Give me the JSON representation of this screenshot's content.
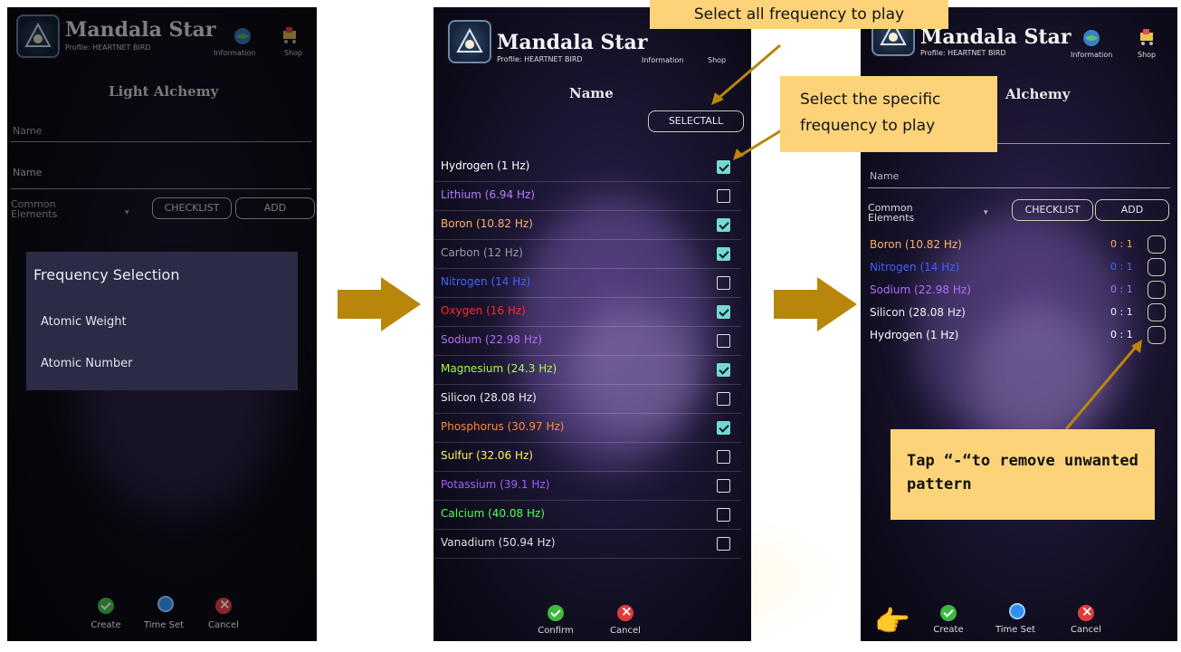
{
  "app": {
    "name": "Mandala Star",
    "profile": "Profile: HEARTNET BIRD",
    "info_label": "Information",
    "shop_label": "Shop"
  },
  "screen1": {
    "title": "Light Alchemy",
    "name_label": "Name",
    "name_value": "Name",
    "common_elements": "Common Elements",
    "checklist_label": "CHECKLIST",
    "add_label": "ADD",
    "menu": {
      "heading": "Frequency Selection",
      "options": [
        "Atomic Weight",
        "Atomic Number"
      ]
    },
    "footer": {
      "create": "Create",
      "time_set": "Time Set",
      "cancel": "Cancel"
    }
  },
  "screen2": {
    "title": "Name",
    "select_all_label": "SELECTALL",
    "items": [
      {
        "label": "Hydrogen (1 Hz)",
        "color": "#ffffff",
        "checked": true
      },
      {
        "label": "Lithium (6.94 Hz)",
        "color": "#b47cff",
        "checked": false
      },
      {
        "label": "Boron (10.82 Hz)",
        "color": "#ffb067",
        "checked": true
      },
      {
        "label": "Carbon (12 Hz)",
        "color": "#9a9aa2",
        "checked": true
      },
      {
        "label": "Nitrogen (14 Hz)",
        "color": "#3f63ff",
        "checked": false
      },
      {
        "label": "Oxygen (16 Hz)",
        "color": "#ff2a2a",
        "checked": true
      },
      {
        "label": "Sodium (22.98 Hz)",
        "color": "#b26cff",
        "checked": false
      },
      {
        "label": "Magnesium (24.3 Hz)",
        "color": "#a8ff3a",
        "checked": true
      },
      {
        "label": "Silicon (28.08 Hz)",
        "color": "#eeeeee",
        "checked": false
      },
      {
        "label": "Phosphorus (30.97 Hz)",
        "color": "#ff8a3a",
        "checked": true
      },
      {
        "label": "Sulfur (32.06 Hz)",
        "color": "#fff25a",
        "checked": false
      },
      {
        "label": "Potassium (39.1 Hz)",
        "color": "#a55dff",
        "checked": false
      },
      {
        "label": "Calcium (40.08 Hz)",
        "color": "#55ff55",
        "checked": false
      },
      {
        "label": "Vanadium (50.94 Hz)",
        "color": "#e0e0e0",
        "checked": false
      }
    ],
    "footer": {
      "confirm": "Confirm",
      "cancel": "Cancel"
    }
  },
  "screen3": {
    "title_partial": "Alchemy",
    "name_label": "Name",
    "common_elements": "Common Elements",
    "checklist_label": "CHECKLIST",
    "add_label": "ADD",
    "patterns": [
      {
        "label": "Boron (10.82 Hz)",
        "color": "#ffb067",
        "ratio": "0 : 1"
      },
      {
        "label": "Nitrogen (14 Hz)",
        "color": "#3f63ff",
        "ratio": "0 : 1"
      },
      {
        "label": "Sodium (22.98 Hz)",
        "color": "#b26cff",
        "ratio": "0 : 1"
      },
      {
        "label": "Silicon (28.08 Hz)",
        "color": "#eeeeee",
        "ratio": "0 : 1"
      },
      {
        "label": "Hydrogen (1 Hz)",
        "color": "#ffffff",
        "ratio": "0 : 1"
      }
    ],
    "footer": {
      "create": "Create",
      "time_set": "Time Set",
      "cancel": "Cancel"
    }
  },
  "callouts": {
    "select_all": "Select all frequency to play",
    "select_specific": "Select the specific frequency to play",
    "remove": "Tap “-“to remove unwanted pattern"
  },
  "colors": {
    "callout_bg": "#fdd37a",
    "arrow": "#b8860b",
    "check_on": "#75d9d2"
  }
}
